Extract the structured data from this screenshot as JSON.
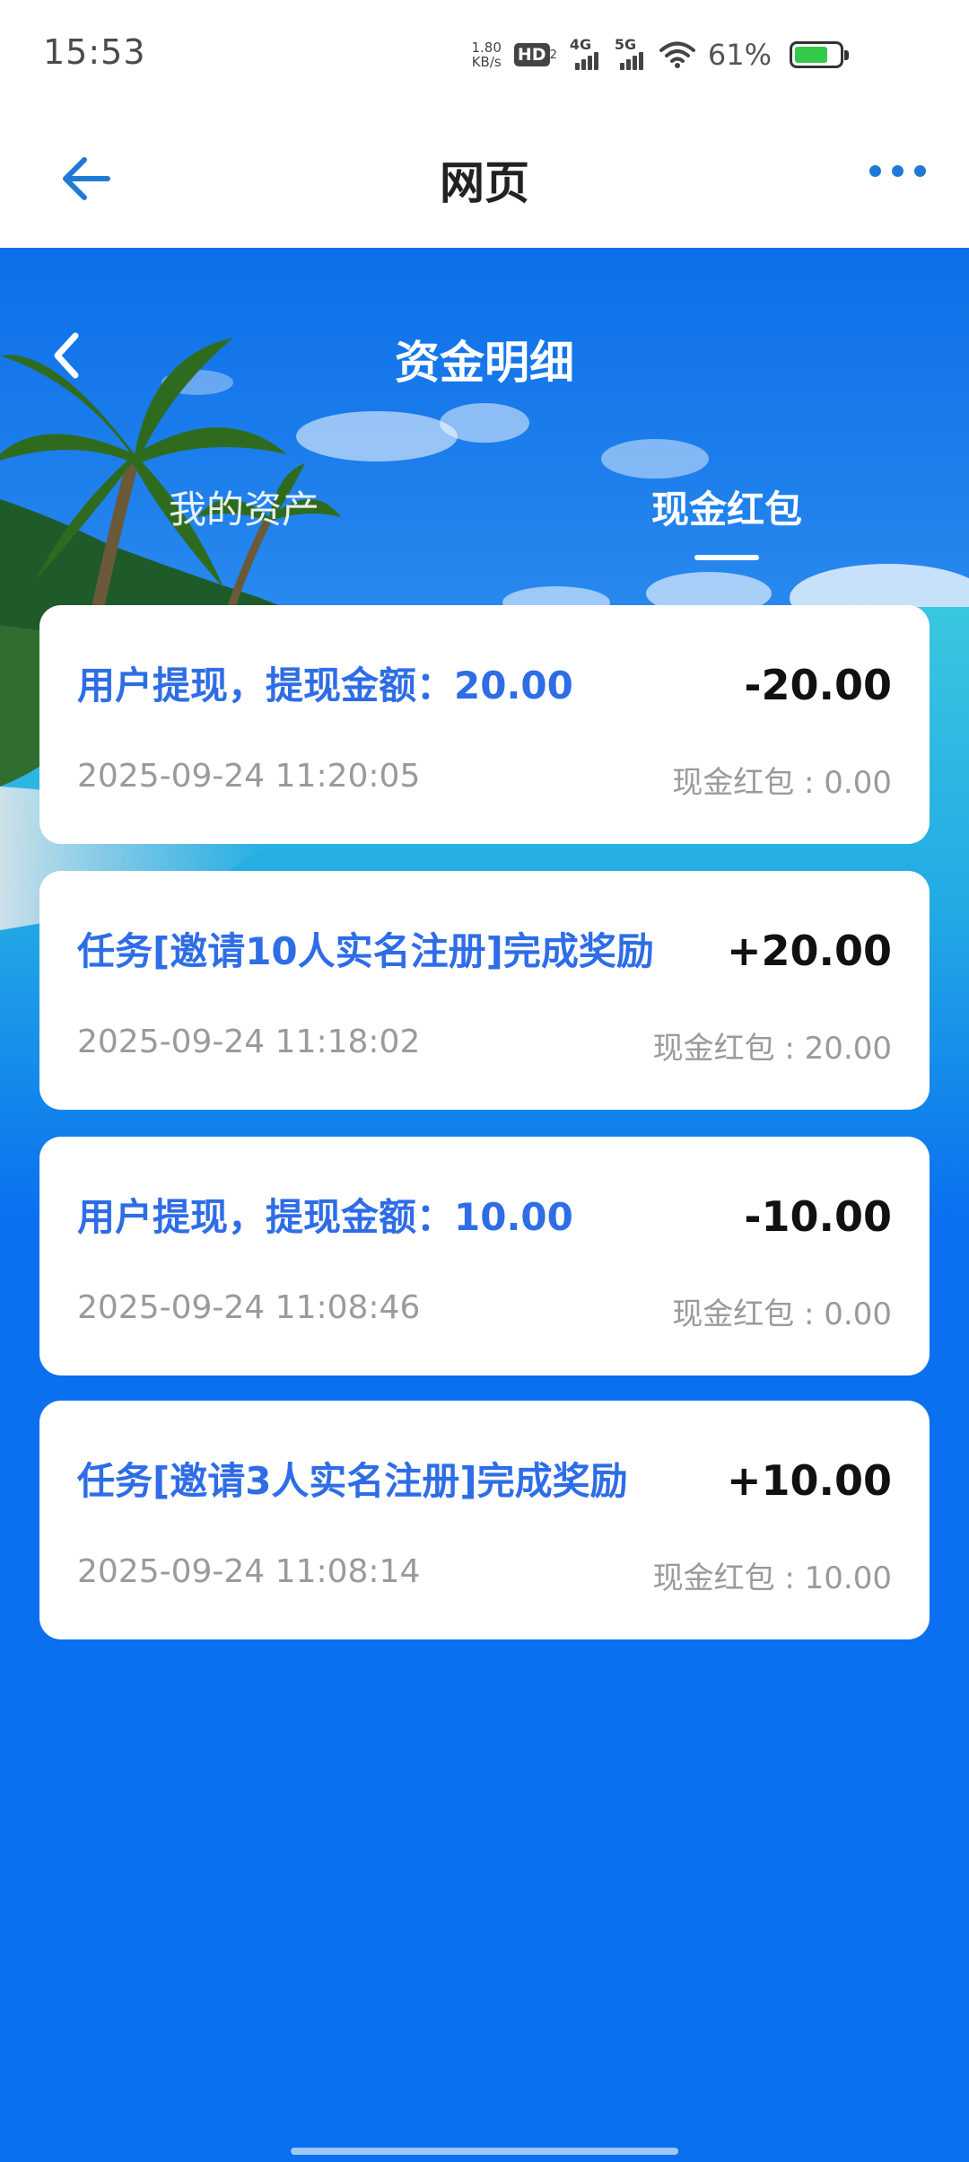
{
  "status_bar": {
    "time": "15:53",
    "net_speed_value": "1.80",
    "net_speed_unit": "KB/s",
    "hd": "HD",
    "hd_sub": "2",
    "sim1": "4G",
    "sim2": "5G",
    "battery_pct": "61%"
  },
  "header": {
    "title": "网页"
  },
  "page": {
    "title": "资金明细",
    "tabs": [
      {
        "label": "我的资产",
        "active": false
      },
      {
        "label": "现金红包",
        "active": true
      }
    ]
  },
  "records": [
    {
      "title": "用户提现，提现金额：20.00",
      "amount": "-20.00",
      "time": "2025-09-24 11:20:05",
      "balance": "现金红包 : 0.00"
    },
    {
      "title": "任务[邀请10人实名注册]完成奖励",
      "amount": "+20.00",
      "time": "2025-09-24 11:18:02",
      "balance": "现金红包 : 20.00"
    },
    {
      "title": "用户提现，提现金额：10.00",
      "amount": "-10.00",
      "time": "2025-09-24 11:08:46",
      "balance": "现金红包 : 0.00"
    },
    {
      "title": "任务[邀请3人实名注册]完成奖励",
      "amount": "+10.00",
      "time": "2025-09-24 11:08:14",
      "balance": "现金红包 : 10.00"
    }
  ],
  "colors": {
    "accent": "#2e6de6",
    "background": "#0a70f0",
    "battery": "#35c94a"
  }
}
